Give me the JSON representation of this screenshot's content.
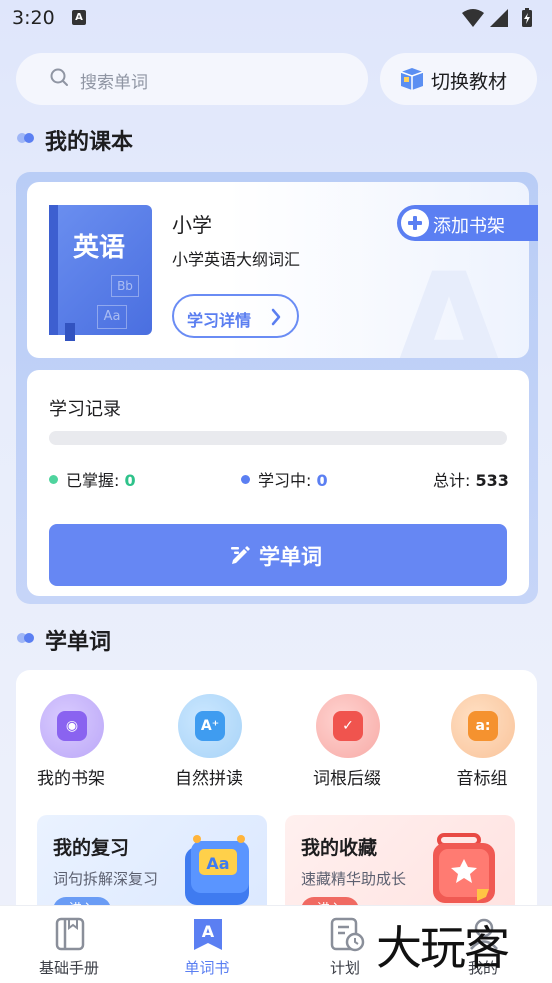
{
  "status_bar": {
    "time": "3:20",
    "notification_icon": "A"
  },
  "search": {
    "placeholder": "搜索单词"
  },
  "switch_textbook": {
    "label": "切换教材"
  },
  "course_section": {
    "title": "我的课本",
    "book": {
      "cover_title": "英语",
      "cover_bb": "Bb",
      "cover_aa": "Aa",
      "bg_letter": "A",
      "level": "小学",
      "name": "小学英语大纲词汇",
      "detail_button": "学习详情",
      "add_shelf_button": "添加书架"
    },
    "record": {
      "title": "学习记录",
      "progress_fraction": 0,
      "mastered_label": "已掌握: ",
      "mastered_value": "0",
      "learning_label": "学习中: ",
      "learning_value": "0",
      "total_label": "总计: ",
      "total_value": "533",
      "learn_button": "学单词"
    }
  },
  "study_section": {
    "title": "学单词",
    "features": [
      {
        "label": "我的书架",
        "icon": "bookshelf-icon"
      },
      {
        "label": "自然拼读",
        "icon": "phonics-icon"
      },
      {
        "label": "词根后缀",
        "icon": "word-root-icon"
      },
      {
        "label": "音标组",
        "icon": "phonetic-icon"
      }
    ],
    "review": {
      "title": "我的复习",
      "subtitle": "词句拆解深复习",
      "enter": "进入"
    },
    "favorites": {
      "title": "我的收藏",
      "subtitle": "速藏精华助成长",
      "enter": "进入"
    }
  },
  "tab_bar": {
    "tabs": [
      {
        "label": "基础手册",
        "icon": "handbook-icon"
      },
      {
        "label": "单词书",
        "icon": "wordbook-icon",
        "active": true
      },
      {
        "label": "计划",
        "icon": "plan-icon"
      },
      {
        "label": "我的",
        "icon": "profile-icon"
      }
    ]
  },
  "watermark": "大玩客",
  "colors": {
    "accent": "#5b7ff2",
    "green": "#2ec28a",
    "card_bg": "#c6d5f8"
  }
}
